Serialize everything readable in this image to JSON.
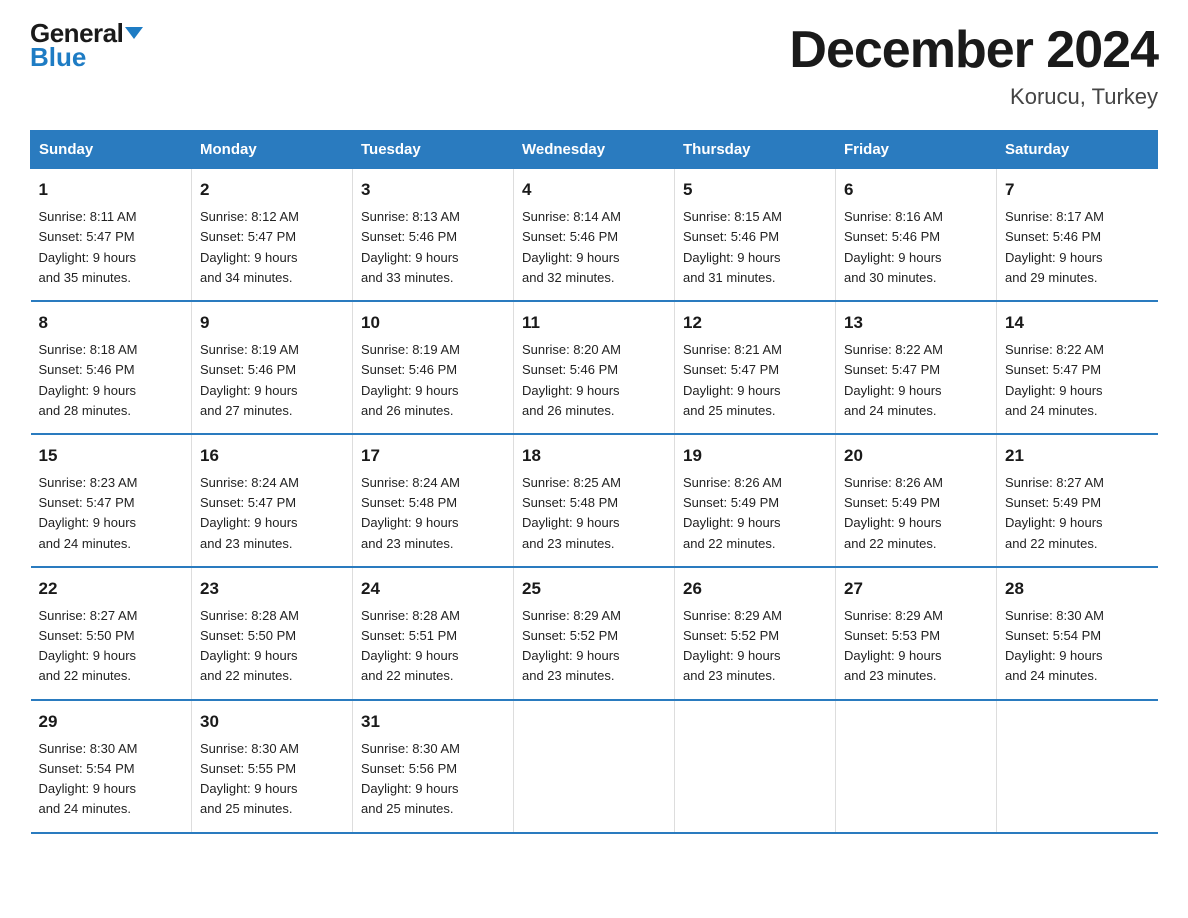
{
  "logo": {
    "general": "General",
    "arrow": "▼",
    "blue": "Blue"
  },
  "title": "December 2024",
  "location": "Korucu, Turkey",
  "days_of_week": [
    "Sunday",
    "Monday",
    "Tuesday",
    "Wednesday",
    "Thursday",
    "Friday",
    "Saturday"
  ],
  "weeks": [
    [
      {
        "num": "1",
        "sunrise": "8:11 AM",
        "sunset": "5:47 PM",
        "daylight": "9 hours and 35 minutes."
      },
      {
        "num": "2",
        "sunrise": "8:12 AM",
        "sunset": "5:47 PM",
        "daylight": "9 hours and 34 minutes."
      },
      {
        "num": "3",
        "sunrise": "8:13 AM",
        "sunset": "5:46 PM",
        "daylight": "9 hours and 33 minutes."
      },
      {
        "num": "4",
        "sunrise": "8:14 AM",
        "sunset": "5:46 PM",
        "daylight": "9 hours and 32 minutes."
      },
      {
        "num": "5",
        "sunrise": "8:15 AM",
        "sunset": "5:46 PM",
        "daylight": "9 hours and 31 minutes."
      },
      {
        "num": "6",
        "sunrise": "8:16 AM",
        "sunset": "5:46 PM",
        "daylight": "9 hours and 30 minutes."
      },
      {
        "num": "7",
        "sunrise": "8:17 AM",
        "sunset": "5:46 PM",
        "daylight": "9 hours and 29 minutes."
      }
    ],
    [
      {
        "num": "8",
        "sunrise": "8:18 AM",
        "sunset": "5:46 PM",
        "daylight": "9 hours and 28 minutes."
      },
      {
        "num": "9",
        "sunrise": "8:19 AM",
        "sunset": "5:46 PM",
        "daylight": "9 hours and 27 minutes."
      },
      {
        "num": "10",
        "sunrise": "8:19 AM",
        "sunset": "5:46 PM",
        "daylight": "9 hours and 26 minutes."
      },
      {
        "num": "11",
        "sunrise": "8:20 AM",
        "sunset": "5:46 PM",
        "daylight": "9 hours and 26 minutes."
      },
      {
        "num": "12",
        "sunrise": "8:21 AM",
        "sunset": "5:47 PM",
        "daylight": "9 hours and 25 minutes."
      },
      {
        "num": "13",
        "sunrise": "8:22 AM",
        "sunset": "5:47 PM",
        "daylight": "9 hours and 24 minutes."
      },
      {
        "num": "14",
        "sunrise": "8:22 AM",
        "sunset": "5:47 PM",
        "daylight": "9 hours and 24 minutes."
      }
    ],
    [
      {
        "num": "15",
        "sunrise": "8:23 AM",
        "sunset": "5:47 PM",
        "daylight": "9 hours and 24 minutes."
      },
      {
        "num": "16",
        "sunrise": "8:24 AM",
        "sunset": "5:47 PM",
        "daylight": "9 hours and 23 minutes."
      },
      {
        "num": "17",
        "sunrise": "8:24 AM",
        "sunset": "5:48 PM",
        "daylight": "9 hours and 23 minutes."
      },
      {
        "num": "18",
        "sunrise": "8:25 AM",
        "sunset": "5:48 PM",
        "daylight": "9 hours and 23 minutes."
      },
      {
        "num": "19",
        "sunrise": "8:26 AM",
        "sunset": "5:49 PM",
        "daylight": "9 hours and 22 minutes."
      },
      {
        "num": "20",
        "sunrise": "8:26 AM",
        "sunset": "5:49 PM",
        "daylight": "9 hours and 22 minutes."
      },
      {
        "num": "21",
        "sunrise": "8:27 AM",
        "sunset": "5:49 PM",
        "daylight": "9 hours and 22 minutes."
      }
    ],
    [
      {
        "num": "22",
        "sunrise": "8:27 AM",
        "sunset": "5:50 PM",
        "daylight": "9 hours and 22 minutes."
      },
      {
        "num": "23",
        "sunrise": "8:28 AM",
        "sunset": "5:50 PM",
        "daylight": "9 hours and 22 minutes."
      },
      {
        "num": "24",
        "sunrise": "8:28 AM",
        "sunset": "5:51 PM",
        "daylight": "9 hours and 22 minutes."
      },
      {
        "num": "25",
        "sunrise": "8:29 AM",
        "sunset": "5:52 PM",
        "daylight": "9 hours and 23 minutes."
      },
      {
        "num": "26",
        "sunrise": "8:29 AM",
        "sunset": "5:52 PM",
        "daylight": "9 hours and 23 minutes."
      },
      {
        "num": "27",
        "sunrise": "8:29 AM",
        "sunset": "5:53 PM",
        "daylight": "9 hours and 23 minutes."
      },
      {
        "num": "28",
        "sunrise": "8:30 AM",
        "sunset": "5:54 PM",
        "daylight": "9 hours and 24 minutes."
      }
    ],
    [
      {
        "num": "29",
        "sunrise": "8:30 AM",
        "sunset": "5:54 PM",
        "daylight": "9 hours and 24 minutes."
      },
      {
        "num": "30",
        "sunrise": "8:30 AM",
        "sunset": "5:55 PM",
        "daylight": "9 hours and 25 minutes."
      },
      {
        "num": "31",
        "sunrise": "8:30 AM",
        "sunset": "5:56 PM",
        "daylight": "9 hours and 25 minutes."
      },
      {
        "num": "",
        "sunrise": "",
        "sunset": "",
        "daylight": ""
      },
      {
        "num": "",
        "sunrise": "",
        "sunset": "",
        "daylight": ""
      },
      {
        "num": "",
        "sunrise": "",
        "sunset": "",
        "daylight": ""
      },
      {
        "num": "",
        "sunrise": "",
        "sunset": "",
        "daylight": ""
      }
    ]
  ],
  "labels": {
    "sunrise": "Sunrise:",
    "sunset": "Sunset:",
    "daylight": "Daylight:"
  }
}
